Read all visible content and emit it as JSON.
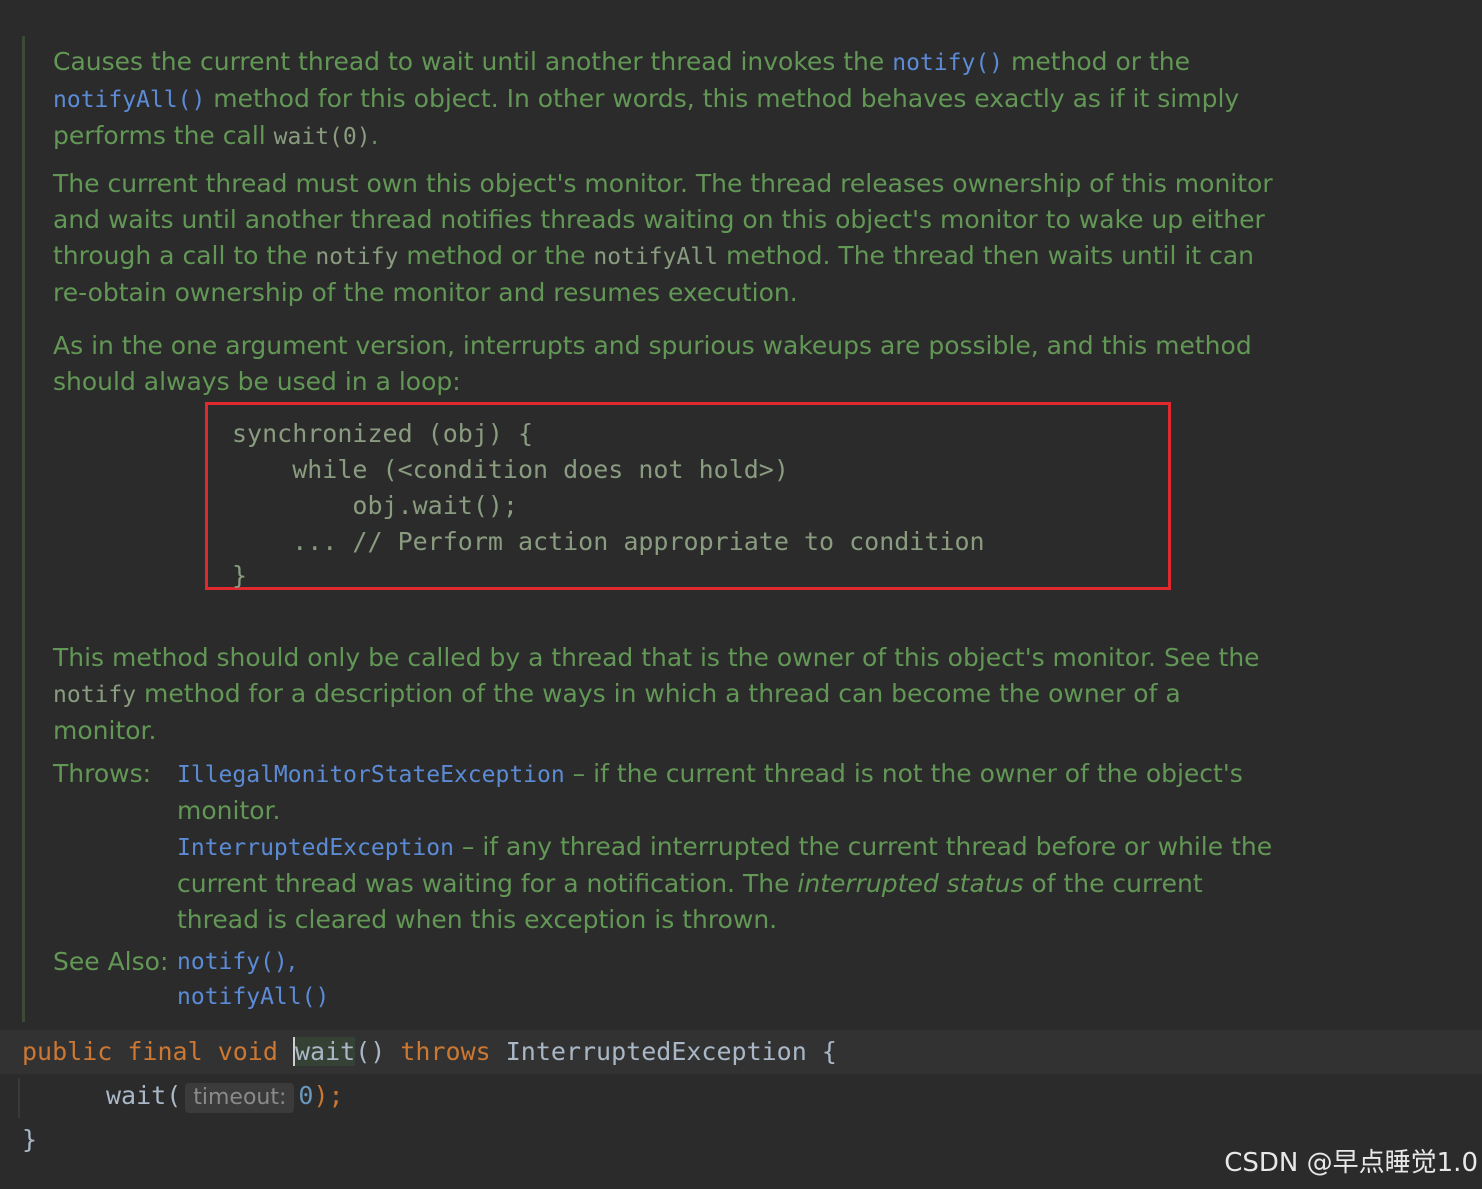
{
  "doc": {
    "p1": {
      "t1": "Causes the current thread to wait until another thread invokes the ",
      "l1": "notify()",
      "t2": " method or the",
      "l2": "notifyAll()",
      "t3": " method for this object. In other words, this method behaves exactly as if it simply",
      "t4": "performs the call ",
      "c1": "wait(0)",
      "t5": "."
    },
    "p2": {
      "line1": "The current thread must own this object's monitor. The thread releases ownership of this monitor",
      "line2": "and waits until another thread notifies threads waiting on this object's monitor to wake up either",
      "t1": "through a call to the ",
      "c1": "notify",
      "t2": " method or the ",
      "c2": "notifyAll",
      "t3": " method. The thread then waits until it can",
      "line4": "re-obtain ownership of the monitor and resumes execution."
    },
    "p3": {
      "line1": "As in the one argument version, interrupts and spurious wakeups are possible, and this method",
      "line2": "should always be used in a loop:"
    },
    "code_example": [
      "synchronized (obj) {",
      "    while (<condition does not hold>)",
      "        obj.wait();",
      "    ... // Perform action appropriate to condition",
      "}"
    ],
    "p4": {
      "line1": "This method should only be called by a thread that is the owner of this object's monitor. See the",
      "c1": "notify",
      "t1": " method for a description of the ways in which a thread can become the owner of a",
      "line3": "monitor."
    },
    "throws": {
      "label": "Throws:",
      "ex1": "IllegalMonitorStateException",
      "ex1_desc1": " – if the current thread is not the owner of the object's",
      "ex1_desc2": "monitor.",
      "ex2": "InterruptedException",
      "ex2_desc1": " – if any thread interrupted the current thread before or while the",
      "ex2_t1": "current thread was waiting for a notification. The ",
      "ex2_it": "interrupted status",
      "ex2_t2": " of the current",
      "ex2_desc3": "thread is cleared when this exception is thrown."
    },
    "see_also": {
      "label": "See Also:",
      "link1": "notify()",
      "sep": ",",
      "link2": "notifyAll()"
    }
  },
  "source": {
    "kw_public": "public",
    "kw_final": "final",
    "kw_void": "void",
    "method_name": "wait",
    "parens": "()",
    "kw_throws": "throws",
    "exception": "InterruptedException",
    "brace_open": "{",
    "call": "wait(",
    "hint": "timeout:",
    "arg": "0",
    "call_end": ");",
    "brace_close": "}"
  },
  "watermark": "CSDN @早点睡觉1.0"
}
